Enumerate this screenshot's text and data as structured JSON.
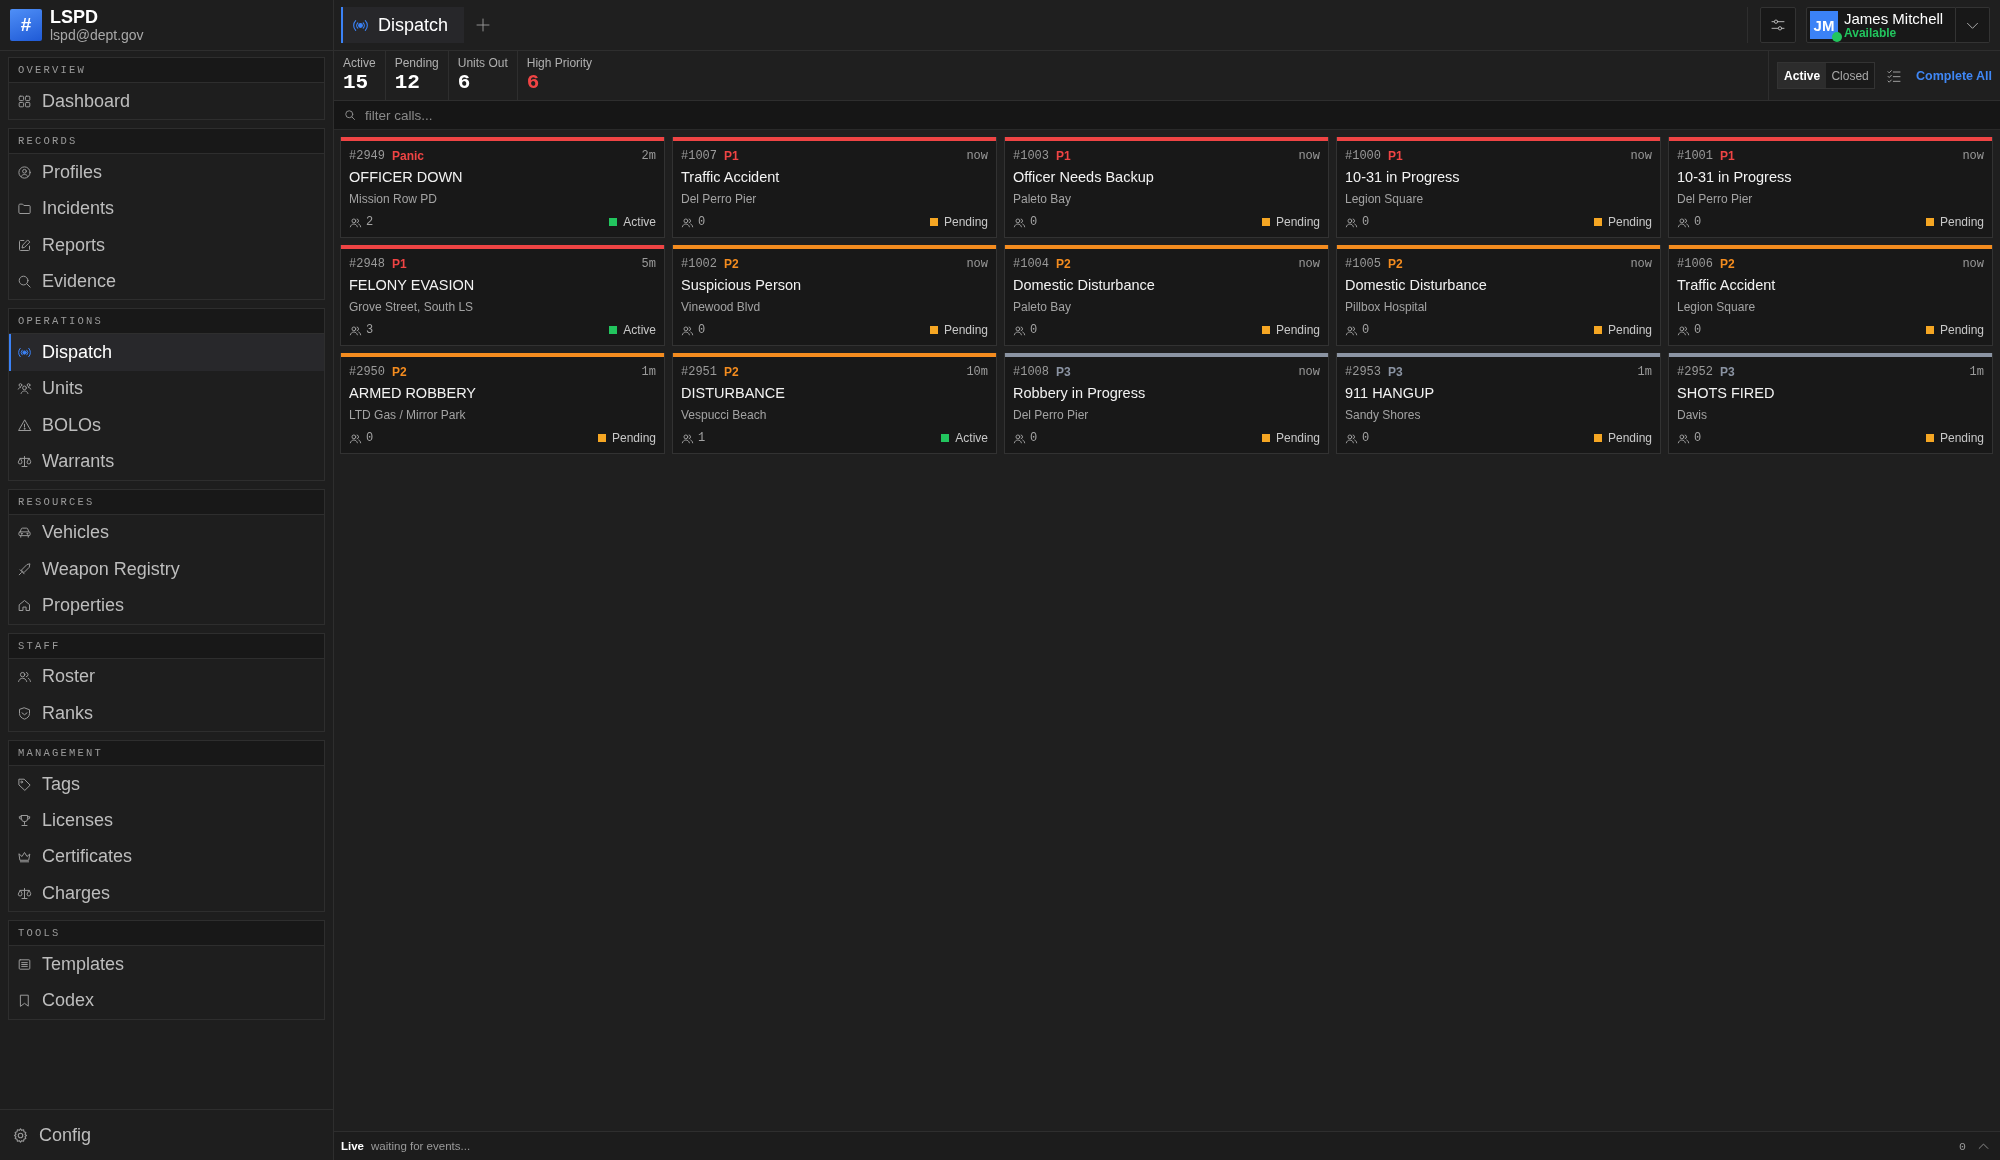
{
  "sidebar": {
    "brand": {
      "logo": "#",
      "name": "LSPD",
      "email": "lspd@dept.gov"
    },
    "groups": [
      {
        "title": "OVERVIEW",
        "items": [
          {
            "label": "Dashboard",
            "selected": false
          }
        ]
      },
      {
        "title": "RECORDS",
        "items": [
          {
            "label": "Profiles",
            "selected": false
          },
          {
            "label": "Incidents",
            "selected": false
          },
          {
            "label": "Reports",
            "selected": false
          },
          {
            "label": "Evidence",
            "selected": false
          }
        ]
      },
      {
        "title": "OPERATIONS",
        "items": [
          {
            "label": "Dispatch",
            "selected": true
          },
          {
            "label": "Units",
            "selected": false
          },
          {
            "label": "BOLOs",
            "selected": false
          },
          {
            "label": "Warrants",
            "selected": false
          }
        ]
      },
      {
        "title": "RESOURCES",
        "items": [
          {
            "label": "Vehicles",
            "selected": false
          },
          {
            "label": "Weapon Registry",
            "selected": false
          },
          {
            "label": "Properties",
            "selected": false
          }
        ]
      },
      {
        "title": "STAFF",
        "items": [
          {
            "label": "Roster",
            "selected": false
          },
          {
            "label": "Ranks",
            "selected": false
          }
        ]
      },
      {
        "title": "MANAGEMENT",
        "items": [
          {
            "label": "Tags",
            "selected": false
          },
          {
            "label": "Licenses",
            "selected": false
          },
          {
            "label": "Certificates",
            "selected": false
          },
          {
            "label": "Charges",
            "selected": false
          }
        ]
      },
      {
        "title": "TOOLS",
        "items": [
          {
            "label": "Templates",
            "selected": false
          },
          {
            "label": "Codex",
            "selected": false
          }
        ]
      }
    ],
    "footer": {
      "label": "Config"
    }
  },
  "topbar": {
    "tabs": [
      {
        "label": "Dispatch",
        "selected": true
      }
    ],
    "user": {
      "initials": "JM",
      "name": "James Mitchell",
      "status": "Available",
      "online": true
    }
  },
  "stats": [
    {
      "label": "Active",
      "value": "15",
      "alert": false
    },
    {
      "label": "Pending",
      "value": "12",
      "alert": false
    },
    {
      "label": "Units Out",
      "value": "6",
      "alert": false
    },
    {
      "label": "High Priority",
      "value": "6",
      "alert": true
    }
  ],
  "view_filter": {
    "segments": [
      {
        "label": "Active",
        "selected": true
      },
      {
        "label": "Closed",
        "selected": false
      }
    ],
    "action": "Complete All"
  },
  "search": {
    "placeholder": "filter calls..."
  },
  "calls": [
    {
      "number": "#2949",
      "priority": "Panic",
      "color": "#ef4444",
      "time": "2m",
      "title": "OFFICER DOWN",
      "location": "Mission Row PD",
      "units": "2",
      "status": {
        "label": "Active",
        "color": "#22c55e"
      }
    },
    {
      "number": "#1007",
      "priority": "P1",
      "color": "#ef4444",
      "time": "now",
      "title": "Traffic Accident",
      "location": "Del Perro Pier",
      "units": "0",
      "status": {
        "label": "Pending",
        "color": "#f5a623"
      }
    },
    {
      "number": "#1003",
      "priority": "P1",
      "color": "#ef4444",
      "time": "now",
      "title": "Officer Needs Backup",
      "location": "Paleto Bay",
      "units": "0",
      "status": {
        "label": "Pending",
        "color": "#f5a623"
      }
    },
    {
      "number": "#1000",
      "priority": "P1",
      "color": "#ef4444",
      "time": "now",
      "title": "10-31 in Progress",
      "location": "Legion Square",
      "units": "0",
      "status": {
        "label": "Pending",
        "color": "#f5a623"
      }
    },
    {
      "number": "#1001",
      "priority": "P1",
      "color": "#ef4444",
      "time": "now",
      "title": "10-31 in Progress",
      "location": "Del Perro Pier",
      "units": "0",
      "status": {
        "label": "Pending",
        "color": "#f5a623"
      }
    },
    {
      "number": "#2948",
      "priority": "P1",
      "color": "#ef4444",
      "time": "5m",
      "title": "FELONY EVASION",
      "location": "Grove Street, South LS",
      "units": "3",
      "status": {
        "label": "Active",
        "color": "#22c55e"
      }
    },
    {
      "number": "#1002",
      "priority": "P2",
      "color": "#f48c1f",
      "time": "now",
      "title": "Suspicious Person",
      "location": "Vinewood Blvd",
      "units": "0",
      "status": {
        "label": "Pending",
        "color": "#f5a623"
      }
    },
    {
      "number": "#1004",
      "priority": "P2",
      "color": "#f48c1f",
      "time": "now",
      "title": "Domestic Disturbance",
      "location": "Paleto Bay",
      "units": "0",
      "status": {
        "label": "Pending",
        "color": "#f5a623"
      }
    },
    {
      "number": "#1005",
      "priority": "P2",
      "color": "#f48c1f",
      "time": "now",
      "title": "Domestic Disturbance",
      "location": "Pillbox Hospital",
      "units": "0",
      "status": {
        "label": "Pending",
        "color": "#f5a623"
      }
    },
    {
      "number": "#1006",
      "priority": "P2",
      "color": "#f48c1f",
      "time": "now",
      "title": "Traffic Accident",
      "location": "Legion Square",
      "units": "0",
      "status": {
        "label": "Pending",
        "color": "#f5a623"
      }
    },
    {
      "number": "#2950",
      "priority": "P2",
      "color": "#f48c1f",
      "time": "1m",
      "title": "ARMED ROBBERY",
      "location": "LTD Gas / Mirror Park",
      "units": "0",
      "status": {
        "label": "Pending",
        "color": "#f5a623"
      }
    },
    {
      "number": "#2951",
      "priority": "P2",
      "color": "#f48c1f",
      "time": "10m",
      "title": "DISTURBANCE",
      "location": "Vespucci Beach",
      "units": "1",
      "status": {
        "label": "Active",
        "color": "#22c55e"
      }
    },
    {
      "number": "#1008",
      "priority": "P3",
      "color": "#8b94a3",
      "time": "now",
      "title": "Robbery in Progress",
      "location": "Del Perro Pier",
      "units": "0",
      "status": {
        "label": "Pending",
        "color": "#f5a623"
      }
    },
    {
      "number": "#2953",
      "priority": "P3",
      "color": "#8b94a3",
      "time": "1m",
      "title": "911 HANGUP",
      "location": "Sandy Shores",
      "units": "0",
      "status": {
        "label": "Pending",
        "color": "#f5a623"
      }
    },
    {
      "number": "#2952",
      "priority": "P3",
      "color": "#8b94a3",
      "time": "1m",
      "title": "SHOTS FIRED",
      "location": "Davis",
      "units": "0",
      "status": {
        "label": "Pending",
        "color": "#f5a623"
      }
    }
  ],
  "status_bar": {
    "state": "Live",
    "message": "waiting for events...",
    "count": "0"
  }
}
